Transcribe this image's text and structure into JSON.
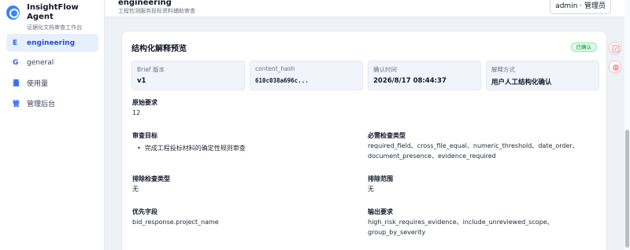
{
  "brand": {
    "title": "InsightFlow Agent",
    "subtitle": "证据化文档审查工作台"
  },
  "sidebar": {
    "items": [
      {
        "letter": "E",
        "label": "engineering",
        "active": true
      },
      {
        "letter": "G",
        "label": "general",
        "active": false
      },
      {
        "letter": "量",
        "label": "使用量",
        "active": false
      },
      {
        "letter": "管",
        "label": "管理后台",
        "active": false
      }
    ]
  },
  "header": {
    "project_title": "engineering",
    "project_subtitle": "工程检测服务投标资料辅助审查",
    "user_badge": "admin · 管理员"
  },
  "card": {
    "title": "结构化解释预览",
    "status": "已确认",
    "meta": [
      {
        "label": "Brief 版本",
        "value": "v1"
      },
      {
        "label": "content_hash",
        "value": "610c038a696c..."
      },
      {
        "label": "确认时间",
        "value": "2026/8/17 08:44:37"
      },
      {
        "label": "解释方式",
        "value": "用户人工结构化确认"
      }
    ],
    "original_request": {
      "label": "原始要求",
      "value": "12"
    },
    "review_goal": {
      "label": "审查目标",
      "items": [
        "完成工程投标材料的确定性规则审查"
      ]
    },
    "required_checks": {
      "label": "必需检查类型",
      "lines": [
        "required_field、cross_file_equal、numeric_threshold、date_order、",
        "document_presence、evidence_required"
      ]
    },
    "excluded_checks": {
      "label": "排除检查类型",
      "value": "无"
    },
    "excluded_scope": {
      "label": "排除范围",
      "value": "无"
    },
    "priority_fields": {
      "label": "优先字段",
      "value": "bid_response.project_name"
    },
    "output_requirements": {
      "label": "输出要求",
      "lines": [
        "high_risk_requires_evidence、include_unreviewed_scope、",
        "group_by_severity"
      ]
    }
  },
  "colors": {
    "accent": "#2563eb",
    "active_bg": "#e8effc",
    "status_green": "#15803d"
  },
  "icons": {
    "brand": "logo-icon",
    "tool_top": "edit-icon",
    "tool_bottom": "ai-assistant-icon"
  }
}
